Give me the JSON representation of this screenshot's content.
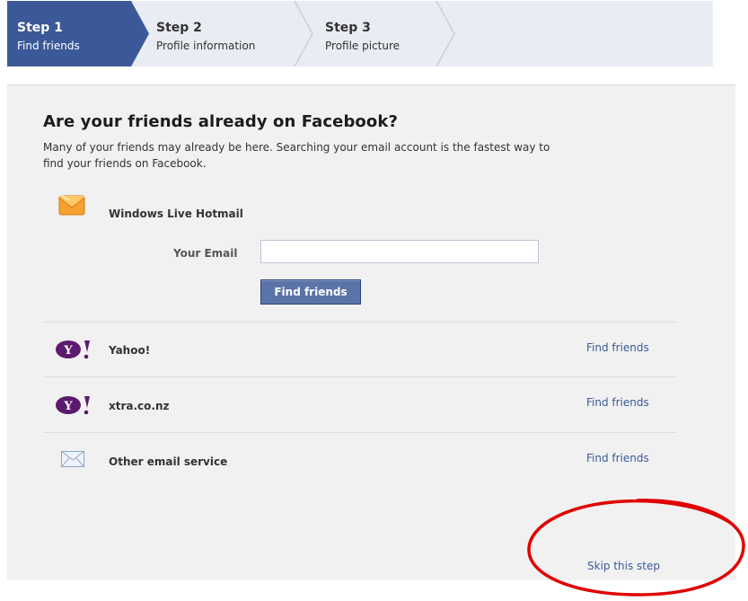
{
  "steps": [
    {
      "num": "Step 1",
      "label": "Find friends",
      "active": true
    },
    {
      "num": "Step 2",
      "label": "Profile information",
      "active": false
    },
    {
      "num": "Step 3",
      "label": "Profile picture",
      "active": false
    }
  ],
  "main": {
    "title": "Are your friends already on Facebook?",
    "description": "Many of your friends may already be here. Searching your email account is the fastest way to find your friends on Facebook.",
    "hotmail": {
      "name": "Windows Live Hotmail",
      "icon": "hotmail-envelope-icon",
      "email_label": "Your Email",
      "email_value": "",
      "button_label": "Find friends"
    },
    "providers": [
      {
        "name": "Yahoo!",
        "icon": "yahoo-icon",
        "link": "Find friends"
      },
      {
        "name": "xtra.co.nz",
        "icon": "yahoo-icon",
        "link": "Find friends"
      },
      {
        "name": "Other email service",
        "icon": "envelope-icon",
        "link": "Find friends"
      }
    ],
    "skip_label": "Skip this step"
  },
  "colors": {
    "active_step": "#3b5998",
    "stepbar_bg": "#e9ecf2",
    "panel_bg": "#f1f1f1",
    "link": "#3b5998",
    "button": "#5b74a8",
    "annotation": "#e00000"
  }
}
